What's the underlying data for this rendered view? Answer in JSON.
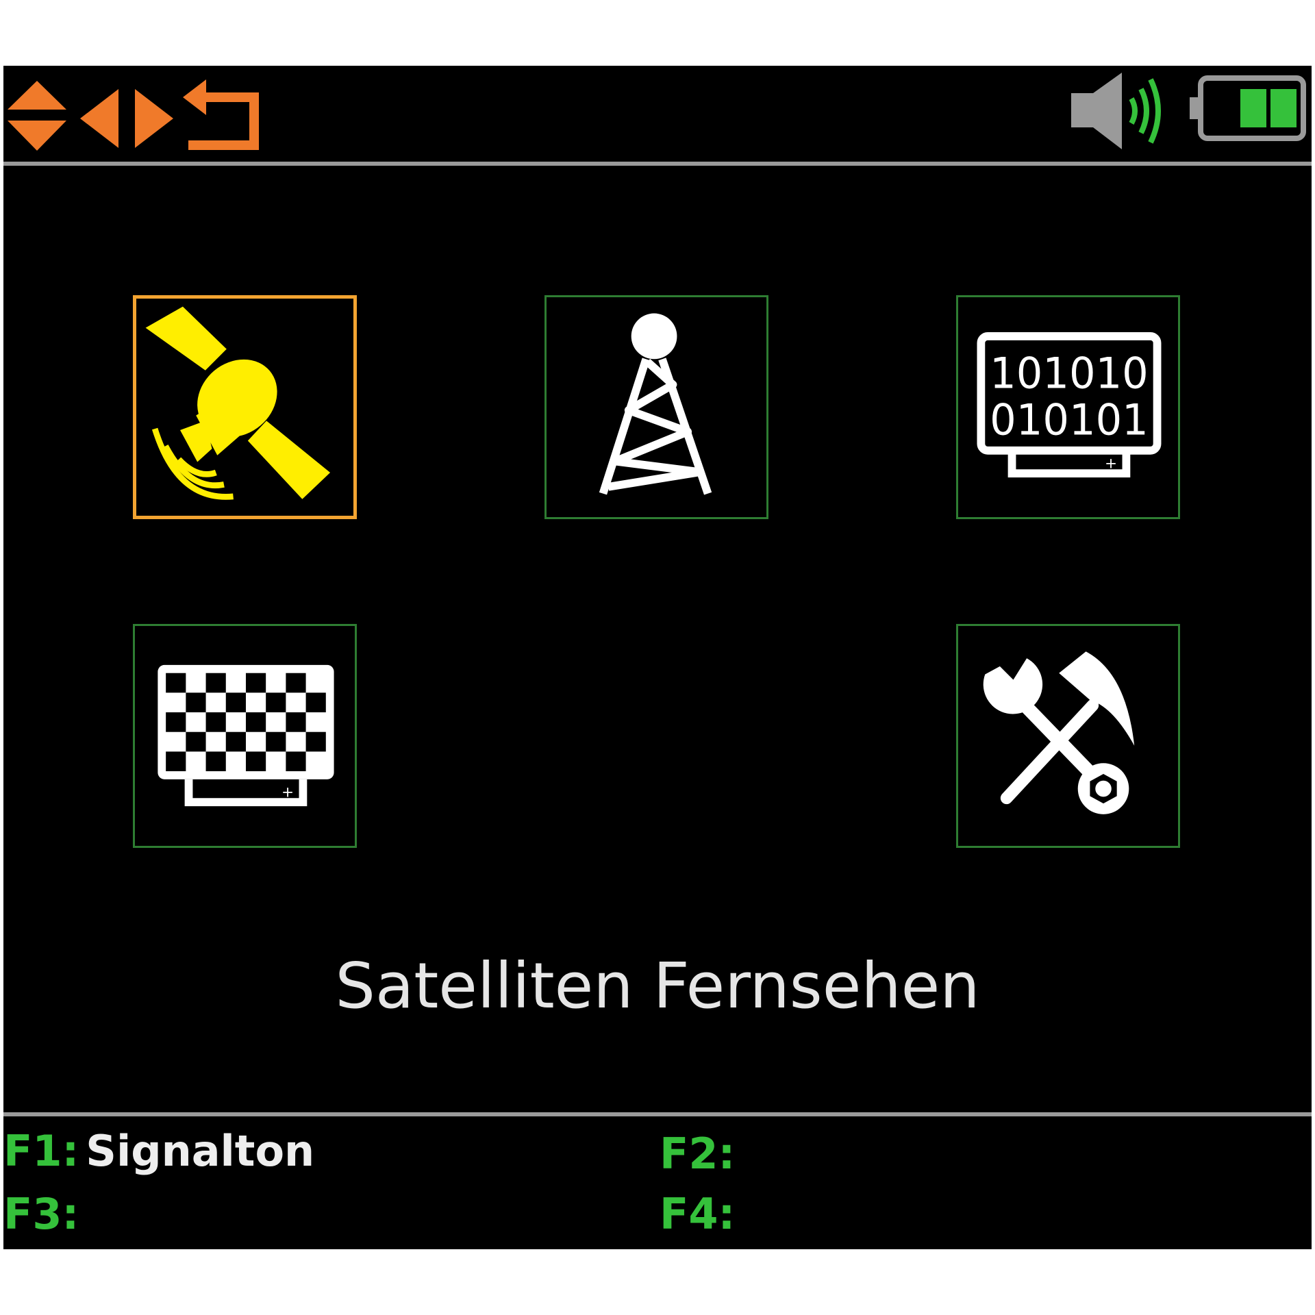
{
  "colors": {
    "background": "#000000",
    "nav_orange": "#f07a2a",
    "selection_border": "#f3a431",
    "tile_border": "#2e7d32",
    "satellite_yellow": "#ffee00",
    "signal_green": "#35c13b",
    "divider_gray": "#9a9a9a",
    "speaker_gray": "#9a9a9a"
  },
  "top_bar": {
    "icons": [
      "up-down-arrows-icon",
      "left-arrow-icon",
      "right-arrow-icon",
      "back-return-icon"
    ],
    "status_icons": [
      "speaker-volume-icon",
      "battery-icon"
    ],
    "battery_level": 0.5
  },
  "menu": {
    "tiles": [
      {
        "icon": "satellite-icon",
        "selected": true
      },
      {
        "icon": "antenna-tower-icon",
        "selected": false
      },
      {
        "icon": "binary-monitor-icon",
        "selected": false,
        "text_line_1": "101010",
        "text_line_2": "010101"
      },
      {
        "icon": "checkerboard-monitor-icon",
        "selected": false
      },
      {
        "icon": "tools-icon",
        "selected": false
      }
    ]
  },
  "title": "Satelliten Fernsehen",
  "function_keys": [
    {
      "label": "F1:",
      "value": "Signalton"
    },
    {
      "label": "F2:",
      "value": ""
    },
    {
      "label": "F3:",
      "value": ""
    },
    {
      "label": "F4:",
      "value": ""
    }
  ]
}
